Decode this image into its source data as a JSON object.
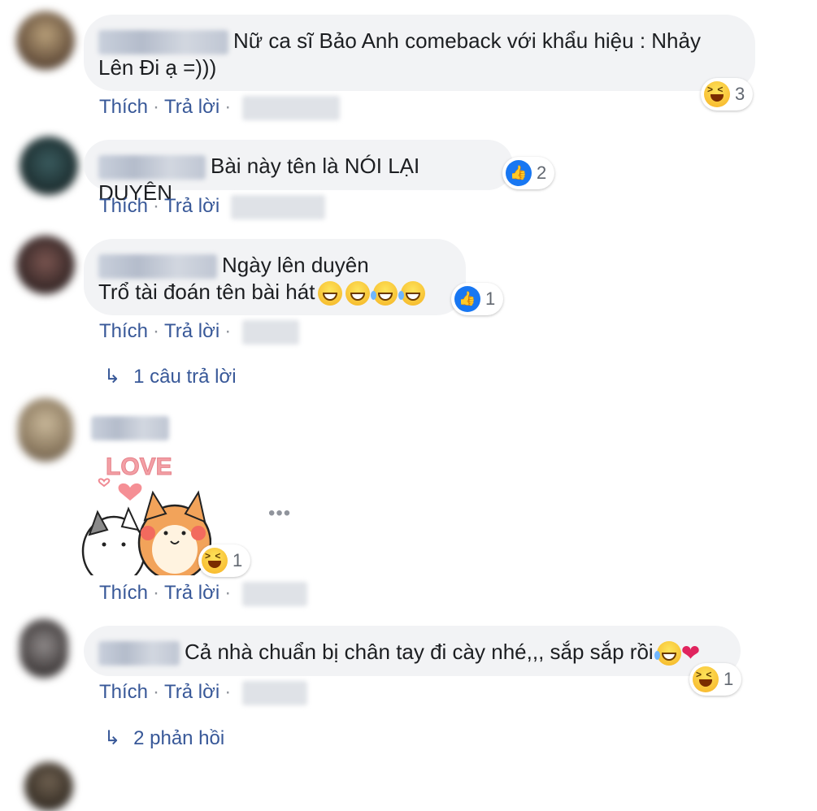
{
  "comments": [
    {
      "text_line1": "Nữ ca sĩ Bảo Anh comeback với khẩu hiệu : Nhảy",
      "text_line2": "Lên Đi ạ =)))",
      "reaction_count": "3",
      "reaction_type": "haha-icon"
    },
    {
      "text_line1": "Bài này tên là NÓI LẠI DUYÊN",
      "reaction_count": "2",
      "reaction_type": "like-icon"
    },
    {
      "text_line1": "Ngày lên duyên",
      "text_line2": "Trổ tài đoán tên bài hát",
      "reaction_count": "1",
      "reaction_type": "like-icon",
      "reply_summary": "1 câu trả lời"
    },
    {
      "sticker_text": "LOVE",
      "reaction_count": "1",
      "reaction_type": "haha-icon"
    },
    {
      "text_line1": "Cả nhà chuẩn bị chân tay đi cày nhé,,, sắp sắp rồi",
      "reaction_count": "1",
      "reaction_type": "haha-icon",
      "reply_summary": "2 phản hồi"
    }
  ],
  "actions": {
    "like_label": "Thích",
    "reply_label": "Trả lời",
    "dot": "·"
  },
  "more_options": "•••",
  "colors": {
    "link": "#385898",
    "bubble": "#f2f3f5",
    "like_blue": "#1877f2",
    "heart": "#e0245e"
  }
}
